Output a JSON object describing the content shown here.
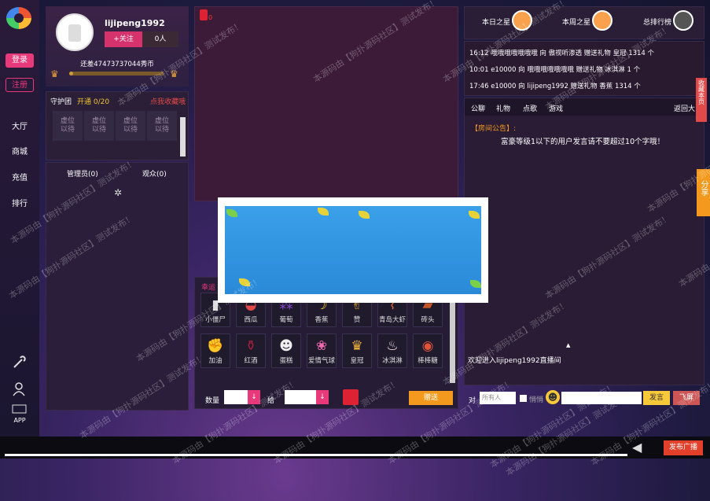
{
  "nav": {
    "login": "登录",
    "register": "注册",
    "items": [
      "大厅",
      "商城",
      "充值",
      "排行"
    ],
    "app_label": "APP"
  },
  "profile": {
    "username": "lijipeng1992",
    "follow": "+关注",
    "fans": "0人",
    "level_text": "还差47473737044秀币",
    "level_progress": 0.04
  },
  "guard": {
    "title": "守护团",
    "open": "开通 0/20",
    "collect": "点我收藏哦",
    "slot_line1": "虚位",
    "slot_line2": "以待"
  },
  "users": {
    "admins_label": "管理员(0)",
    "audience_label": "观众(0)"
  },
  "video": {
    "badge": "0"
  },
  "gifts": {
    "tab": "幸运",
    "items": [
      {
        "name": "小僵尸",
        "icon": "zombie-icon",
        "glyph": "▮",
        "color": "#ddd"
      },
      {
        "name": "西瓜",
        "icon": "watermelon-icon",
        "glyph": "◒",
        "color": "#e24a4a"
      },
      {
        "name": "葡萄",
        "icon": "grape-icon",
        "glyph": "⁂",
        "color": "#8a4ad0"
      },
      {
        "name": "香蕉",
        "icon": "banana-icon",
        "glyph": "☽",
        "color": "#f2c431"
      },
      {
        "name": "赞",
        "icon": "thumbs-up-icon",
        "glyph": "✌",
        "color": "#e8a838"
      },
      {
        "name": "青岛大虾",
        "icon": "shrimp-icon",
        "glyph": "⌇",
        "color": "#e2663a"
      },
      {
        "name": "砖头",
        "icon": "brick-icon",
        "glyph": "▰",
        "color": "#c0582a"
      },
      {
        "name": "加油",
        "icon": "cheer-icon",
        "glyph": "✊",
        "color": "#f3a122"
      },
      {
        "name": "红酒",
        "icon": "wine-icon",
        "glyph": "⚱",
        "color": "#a3223a"
      },
      {
        "name": "蛋糕",
        "icon": "panda-icon",
        "glyph": "☻",
        "color": "#eee"
      },
      {
        "name": "爱情气球",
        "icon": "balloon-icon",
        "glyph": "❀",
        "color": "#f06ab0"
      },
      {
        "name": "皇冠",
        "icon": "crown-icon",
        "glyph": "♛",
        "color": "#f2b53a"
      },
      {
        "name": "冰淇淋",
        "icon": "icecream-icon",
        "glyph": "♨",
        "color": "#f5e1e8"
      },
      {
        "name": "棒棒糖",
        "icon": "lollipop-icon",
        "glyph": "◉",
        "color": "#e0553a"
      }
    ],
    "quantity_label": "数量",
    "to_label": "给",
    "send_label": "赠送"
  },
  "ranks": {
    "today": "本日之星",
    "week": "本周之星",
    "total": "总排行榜"
  },
  "gift_messages": [
    "16:12 哦哦哦哦哦哦哦 向 傲视听渗透 赠送礼物 皇冠 1314 个",
    "10:01 e10000 向 哦哦哦哦哦哦哦 赠送礼物 冰淇淋 1 个",
    "17:46 e10000 向 lijipeng1992 赠送礼物 香蕉 1314 个"
  ],
  "chat": {
    "tabs": [
      "公聊",
      "礼物",
      "点歌",
      "游戏"
    ],
    "back": "返回大",
    "announcement_label": "【房间公告】:",
    "announcement": "富豪等级1以下的用户发言请不要超过10个字哦！",
    "welcome": "欢迎进入lijipeng1992直播间",
    "to_label": "对",
    "recipient": "所有人",
    "private_label": "悄悄",
    "send": "发言",
    "fly": "飞屏"
  },
  "side": {
    "favorite": "收藏本页",
    "share": "分享"
  },
  "bottom": {
    "broadcast": "发布广播"
  },
  "watermark": "本源码由【狗扑源码社区】测试发布！",
  "colors": {
    "accent_pink": "#d6336c",
    "send_orange": "#f39a1e",
    "broadcast_red": "#e2402a"
  }
}
